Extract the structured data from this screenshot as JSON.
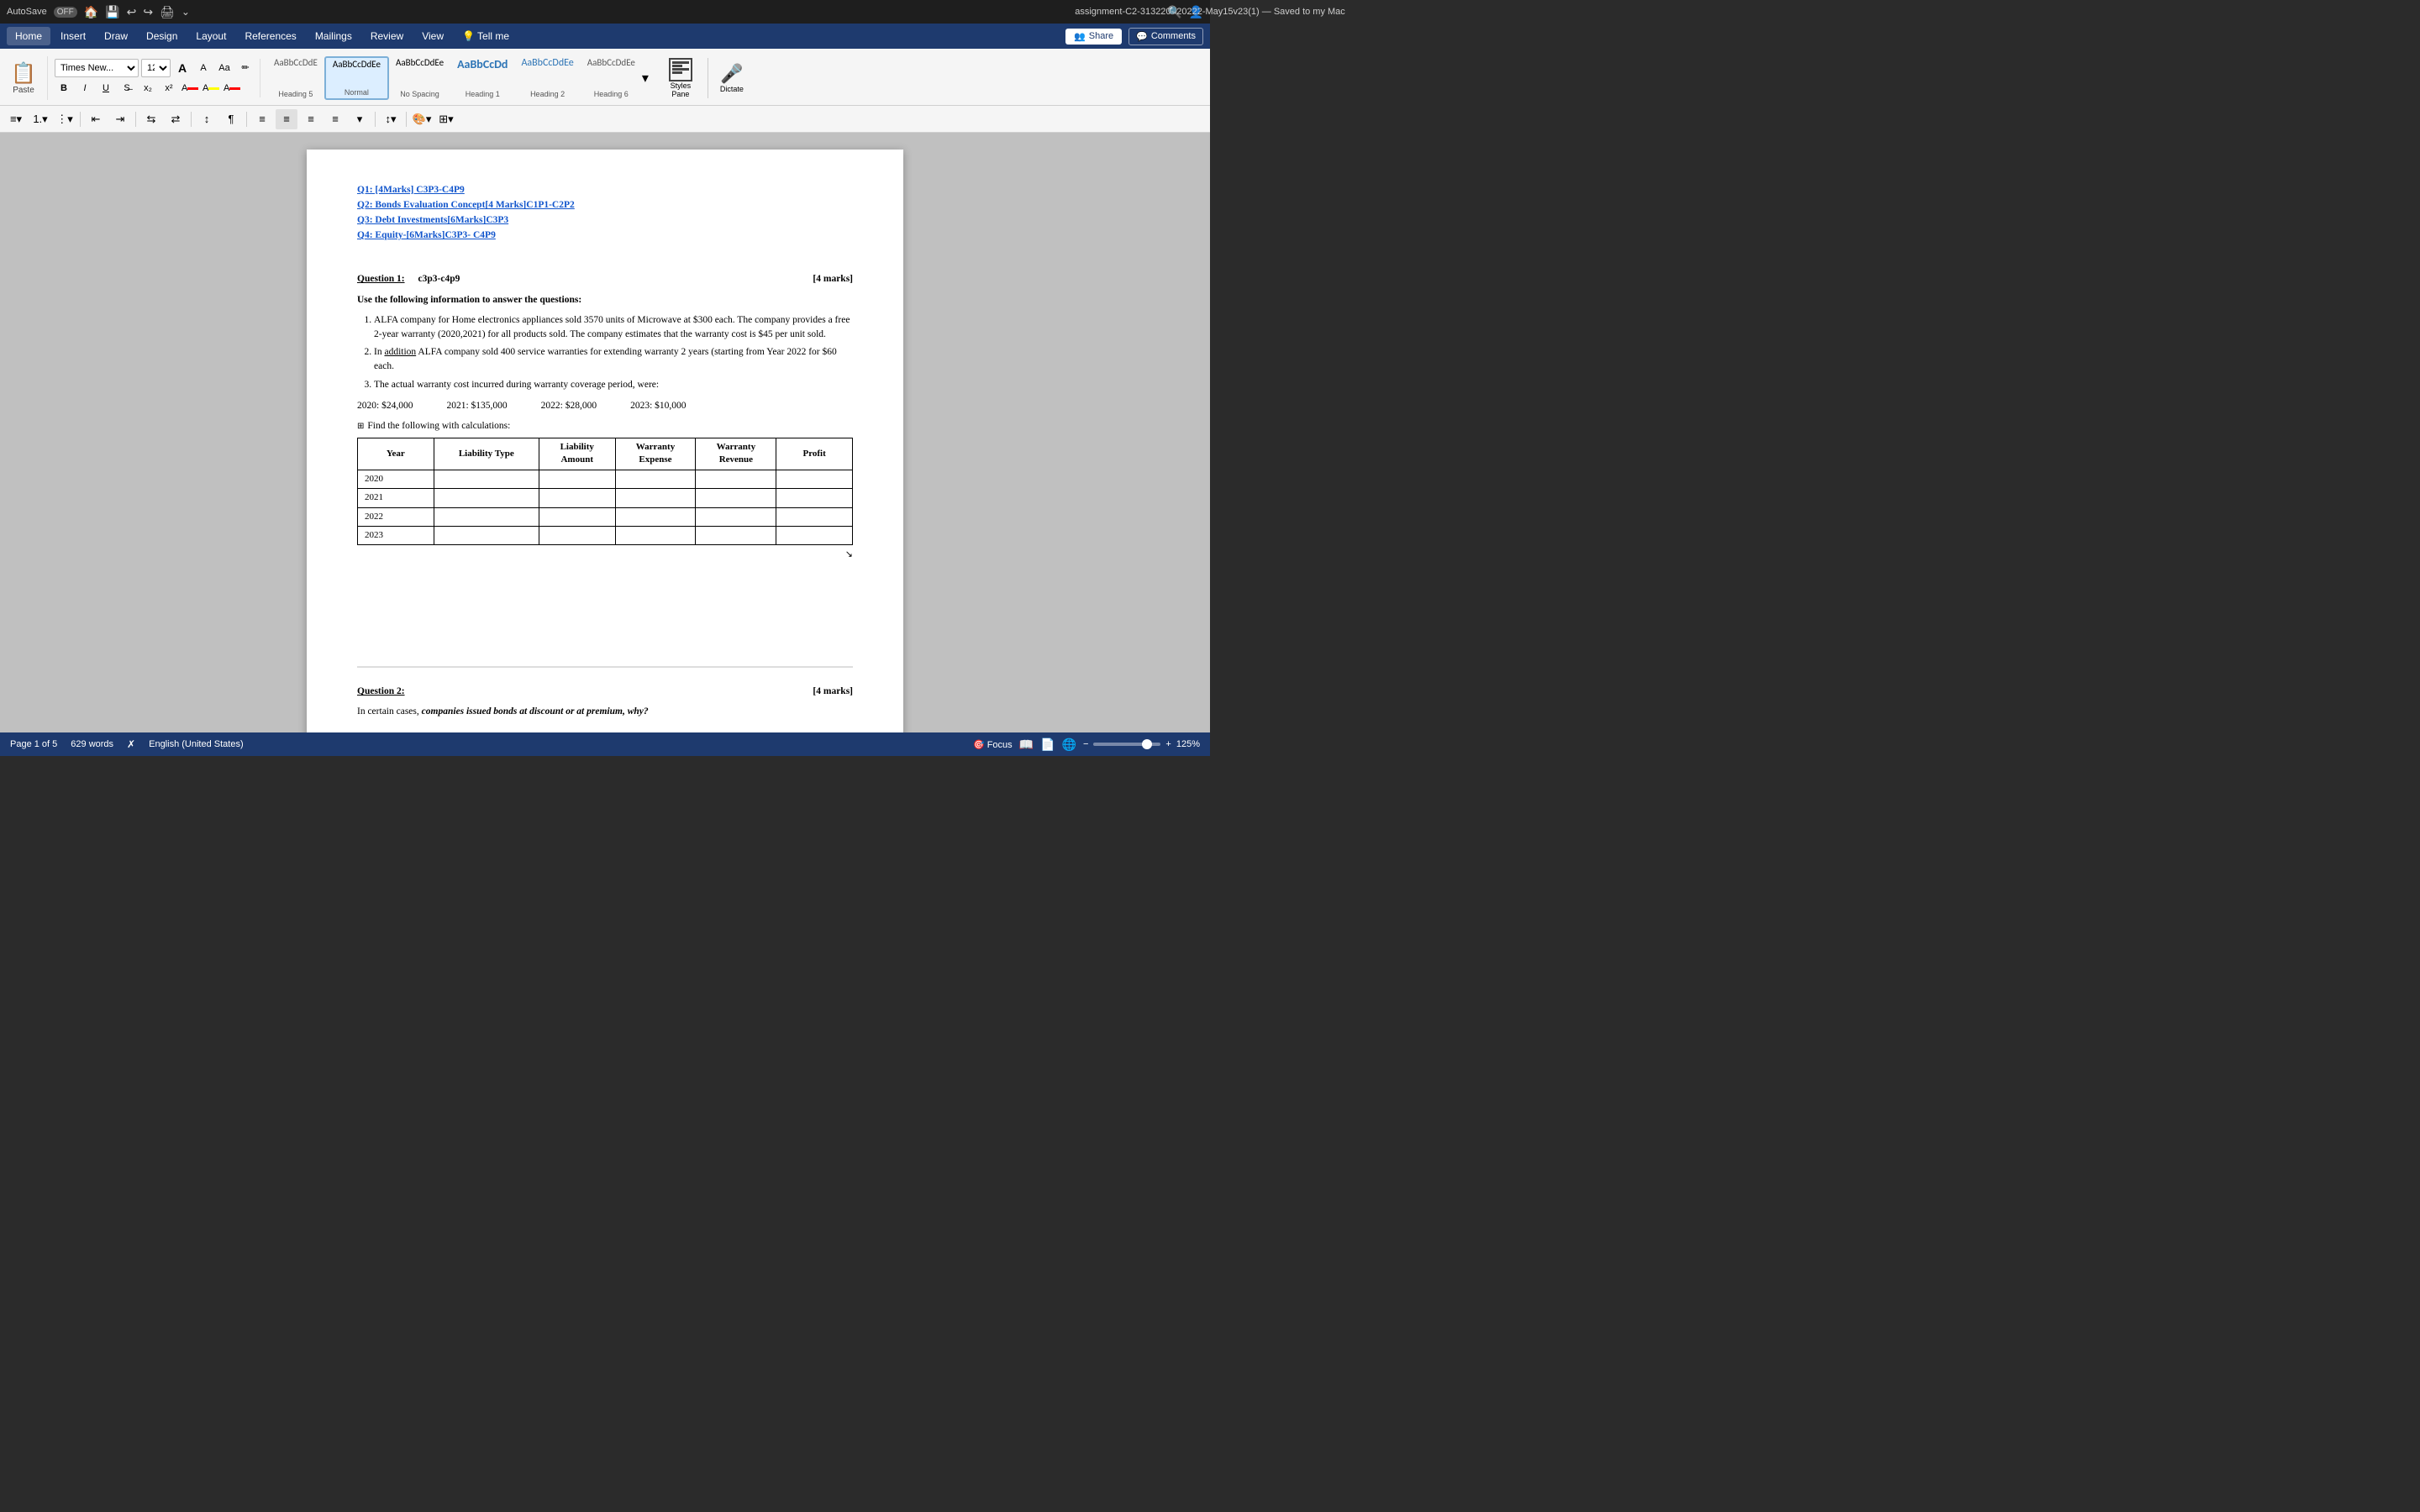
{
  "titlebar": {
    "autosave_label": "AutoSave",
    "autosave_state": "OFF",
    "title": "assignment-C2-313220- 20222-May15v23(1) — Saved to my Mac",
    "save_icon": "💾",
    "undo_icon": "↩",
    "redo_icon": "↪",
    "print_icon": "🖨"
  },
  "menubar": {
    "items": [
      "Home",
      "Insert",
      "Draw",
      "Design",
      "Layout",
      "References",
      "Mailings",
      "Review",
      "View",
      "Tell me"
    ],
    "share_label": "Share",
    "comments_label": "Comments"
  },
  "ribbon": {
    "paste_label": "Paste",
    "font_name": "Times New...",
    "font_size": "12",
    "styles": [
      {
        "id": "heading5",
        "preview": "AaBbCcDdE",
        "label": "Heading 5"
      },
      {
        "id": "normal",
        "preview": "AaBbCcDdEe",
        "label": "Normal",
        "active": true
      },
      {
        "id": "nospacing",
        "preview": "AaBbCcDdEe",
        "label": "No Spacing"
      },
      {
        "id": "heading1",
        "preview": "AaBbCcDd",
        "label": "Heading 1"
      },
      {
        "id": "heading2",
        "preview": "AaBbCcDdEe",
        "label": "Heading 2"
      },
      {
        "id": "heading6",
        "preview": "AaBbCcDdEe",
        "label": "Heading 6"
      }
    ],
    "styles_pane_label": "Styles\nPane",
    "dictate_label": "Dictate"
  },
  "document": {
    "question_links": [
      "Q1: [4Marks] C3P3-C4P9",
      "Q2: Bonds Evaluation Concept[4 Marks]C1P1-C2P2",
      "Q3: Debt Investments[6Marks]C3P3",
      "Q4: Equity-[6Marks]C3P3- C4P9"
    ],
    "q1": {
      "label": "Question 1:",
      "subtitle": "c3p3-c4p9",
      "marks": "[4 marks]",
      "instruction": "Use the following information to answer the questions:",
      "items": [
        "ALFA company for Home electronics appliances sold 3570 units of Microwave at $300 each. The company provides a free 2-year warranty (2020,2021) for all products sold. The company estimates that the warranty cost is $45 per unit sold.",
        "In addition ALFA company sold 400 service warranties for extending warranty 2 years (starting from Year 2022 for $60 each.",
        "The actual warranty cost incurred during warranty coverage period, were:"
      ],
      "warranty_costs": {
        "2020": "$24,000",
        "2021": "$135,000",
        "2022": "$28,000",
        "2023": "$10,000"
      },
      "find_text": "Find the following with calculations:",
      "table": {
        "headers": [
          "Year",
          "Liability Type",
          "Liability Amount",
          "Warranty Expense",
          "Warranty Revenue",
          "Profit"
        ],
        "rows": [
          [
            "2020",
            "",
            "",
            "",
            "",
            ""
          ],
          [
            "2021",
            "",
            "",
            "",
            "",
            ""
          ],
          [
            "2022",
            "",
            "",
            "",
            "",
            ""
          ],
          [
            "2023",
            "",
            "",
            "",
            "",
            ""
          ]
        ]
      }
    },
    "q2": {
      "label": "Question 2:",
      "marks": "[4 marks]",
      "text_before": "In certain cases,",
      "text_italic": "companies issued bonds at discount or at premium, why?"
    }
  },
  "statusbar": {
    "page_info": "Page 1 of 5",
    "words": "629 words",
    "language": "English (United States)",
    "zoom": "125%"
  }
}
